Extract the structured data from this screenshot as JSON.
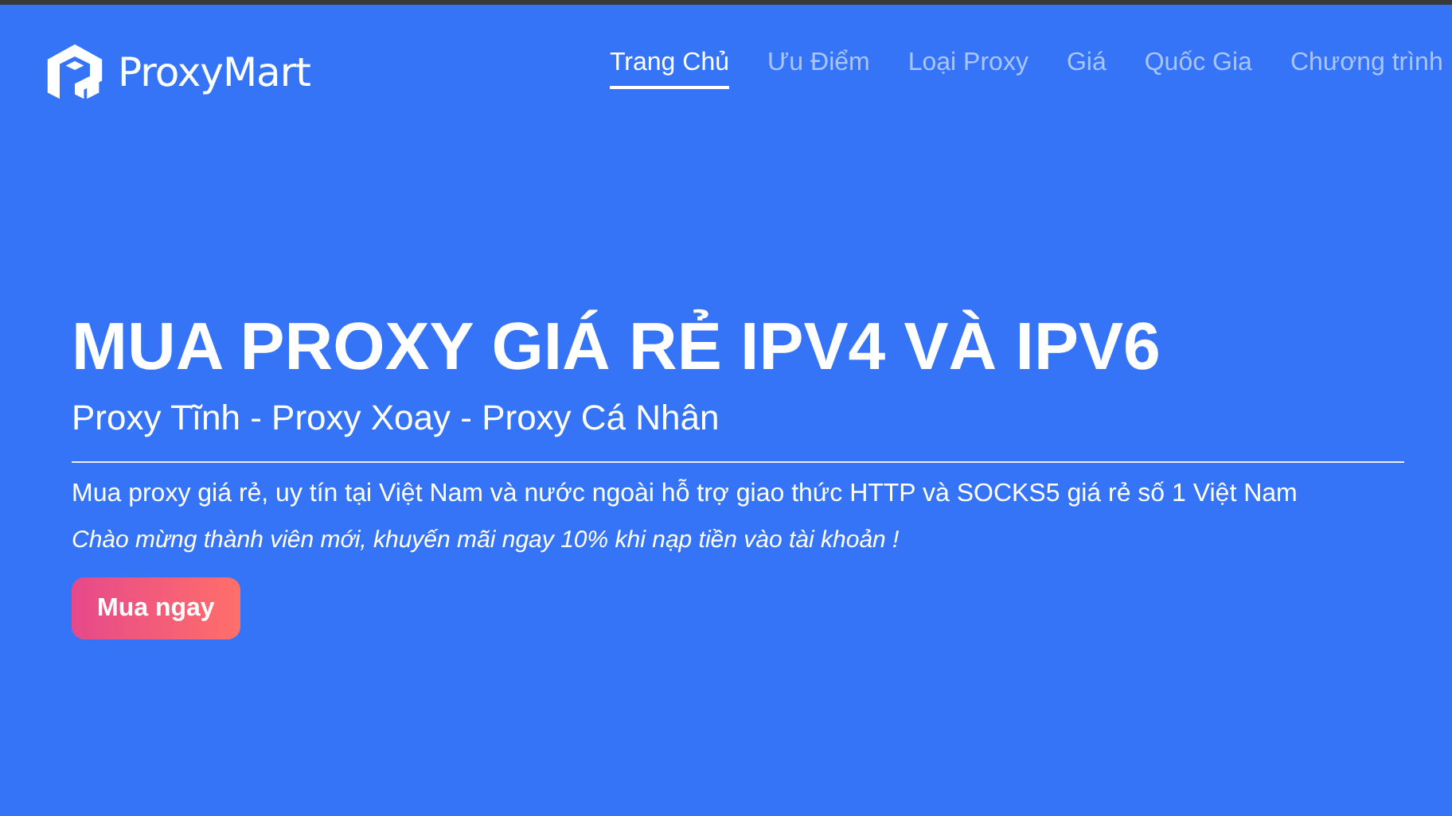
{
  "brand": {
    "name": "ProxyMart"
  },
  "nav": [
    {
      "label": "Trang Chủ",
      "selected": true
    },
    {
      "label": "Ưu Điểm",
      "selected": false
    },
    {
      "label": "Loại Proxy",
      "selected": false
    },
    {
      "label": "Giá",
      "selected": false
    },
    {
      "label": "Quốc Gia",
      "selected": false
    },
    {
      "label": "Chương trình",
      "selected": false
    }
  ],
  "hero": {
    "title": "MUA PROXY GIÁ RẺ IPV4 VÀ IPV6",
    "subtitle": "Proxy Tĩnh - Proxy Xoay - Proxy Cá Nhân",
    "description": "Mua proxy giá rẻ, uy tín tại Việt Nam và nước ngoài hỗ trợ giao thức HTTP và SOCKS5 giá rẻ số 1 Việt Nam",
    "promo": "Chào mừng thành viên mới, khuyến mãi ngay 10% khi nạp tiền vào tài khoản !",
    "button": "Mua ngay"
  }
}
